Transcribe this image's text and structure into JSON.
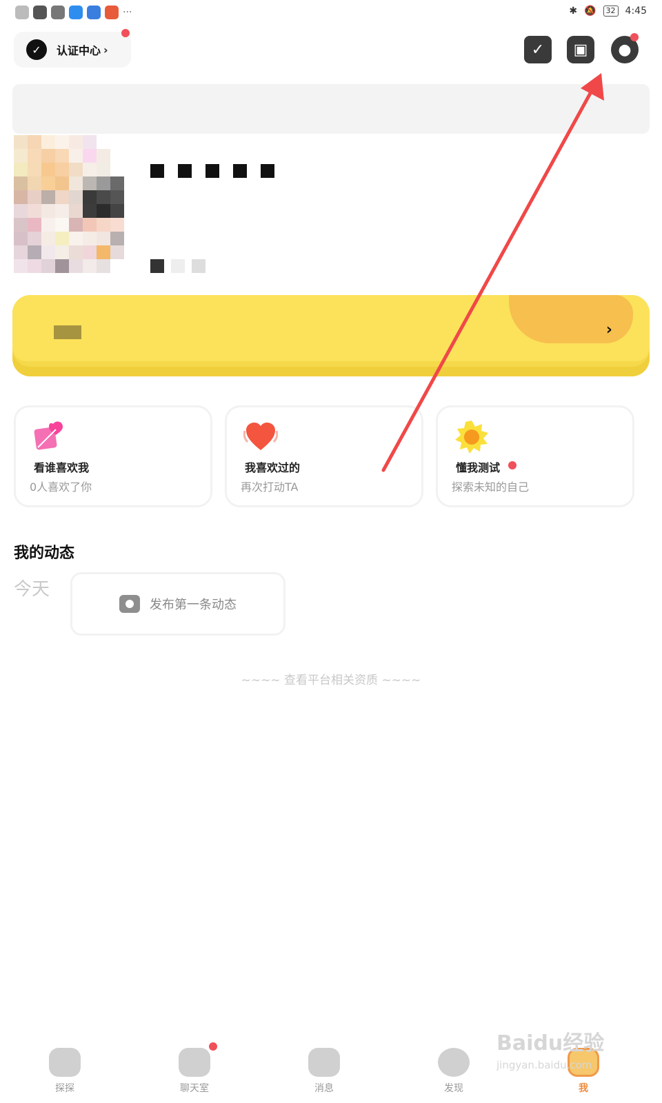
{
  "status_bar": {
    "time": "4:45",
    "battery": "32"
  },
  "header": {
    "cert_label": "认证中心"
  },
  "cards": [
    {
      "title": "看谁喜欢我",
      "subtitle": "0人喜欢了你"
    },
    {
      "title": "我喜欢过的",
      "subtitle": "再次打动TA"
    },
    {
      "title": "懂我测试",
      "subtitle": "探索未知的自己"
    }
  ],
  "moments": {
    "title": "我的动态",
    "day": "今天",
    "post_prompt": "发布第一条动态",
    "footnote": "~~~~ 查看平台相关资质 ~~~~"
  },
  "nav": [
    {
      "label": "探探"
    },
    {
      "label": "聊天室"
    },
    {
      "label": "消息"
    },
    {
      "label": "发现"
    },
    {
      "label": "我"
    }
  ],
  "watermark": {
    "brand": "Baidu经验",
    "url": "jingyan.baidu.com"
  },
  "colors": {
    "accent_yellow": "#fbe25a",
    "badge_red": "#f0505a",
    "nav_active": "#f08a3a"
  }
}
